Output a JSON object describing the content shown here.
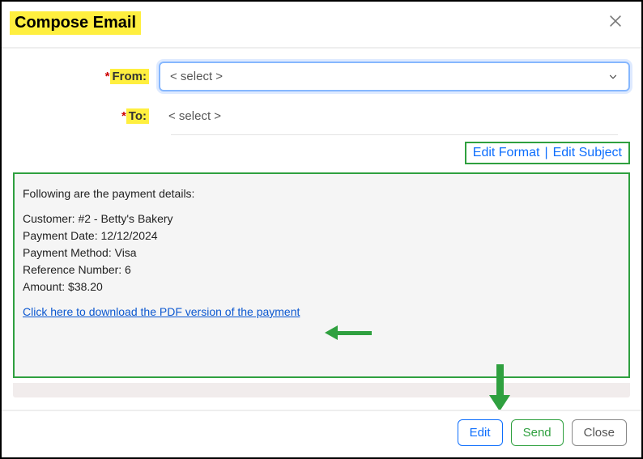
{
  "header": {
    "title": "Compose Email"
  },
  "form": {
    "from_label": "From:",
    "from_placeholder": "< select >",
    "to_label": "To:",
    "to_placeholder": "< select >"
  },
  "format_links": {
    "edit_format": "Edit Format",
    "separator": "|",
    "edit_subject": "Edit Subject"
  },
  "body": {
    "intro": "Following are the payment details:",
    "customer_line": "Customer: #2 - Betty's Bakery",
    "date_line": "Payment Date: 12/12/2024",
    "method_line": "Payment Method: Visa",
    "ref_line": "Reference Number: 6",
    "amount_line": "Amount: $38.20",
    "pdf_link_text": "Click here to download the PDF version of the payment"
  },
  "footer": {
    "edit": "Edit",
    "send": "Send",
    "close": "Close"
  }
}
